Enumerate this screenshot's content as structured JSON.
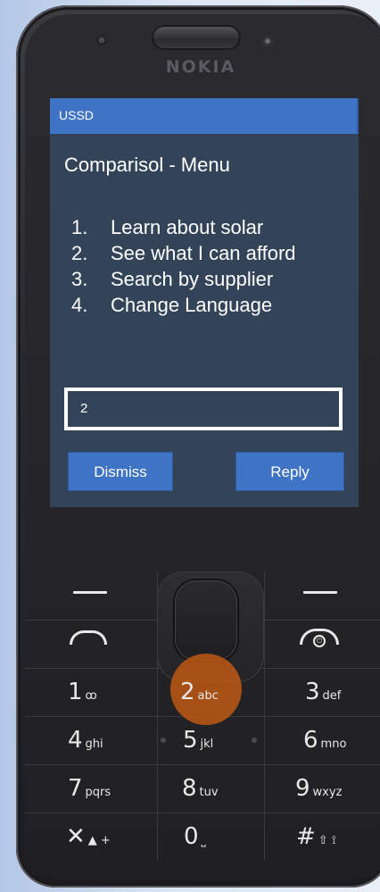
{
  "device": {
    "brand": "NOKIA"
  },
  "ussd": {
    "header": "USSD",
    "title": "Comparisol - Menu",
    "menu": [
      {
        "num": "1.",
        "label": "Learn about solar"
      },
      {
        "num": "2.",
        "label": "See what I can afford"
      },
      {
        "num": "3.",
        "label": "Search by supplier"
      },
      {
        "num": "4.",
        "label": "Change Language"
      }
    ],
    "input_value": "2",
    "dismiss_label": "Dismiss",
    "reply_label": "Reply"
  },
  "keypad": {
    "keys": [
      {
        "digit": "1",
        "letters": "ꝏ"
      },
      {
        "digit": "2",
        "letters": "abc"
      },
      {
        "digit": "3",
        "letters": "def"
      },
      {
        "digit": "4",
        "letters": "ghi"
      },
      {
        "digit": "5",
        "letters": "jkl"
      },
      {
        "digit": "6",
        "letters": "mno"
      },
      {
        "digit": "7",
        "letters": "pqrs"
      },
      {
        "digit": "8",
        "letters": "tuv"
      },
      {
        "digit": "9",
        "letters": "wxyz"
      },
      {
        "digit": "✕",
        "letters": "▲ +"
      },
      {
        "digit": "0",
        "letters": "⎵"
      },
      {
        "digit": "#",
        "letters": "⇧ ⟟"
      }
    ],
    "pressed_key": "2"
  },
  "colors": {
    "accent": "#3f73c3",
    "screen_bg": "#344458",
    "highlight": "#c45a14"
  }
}
